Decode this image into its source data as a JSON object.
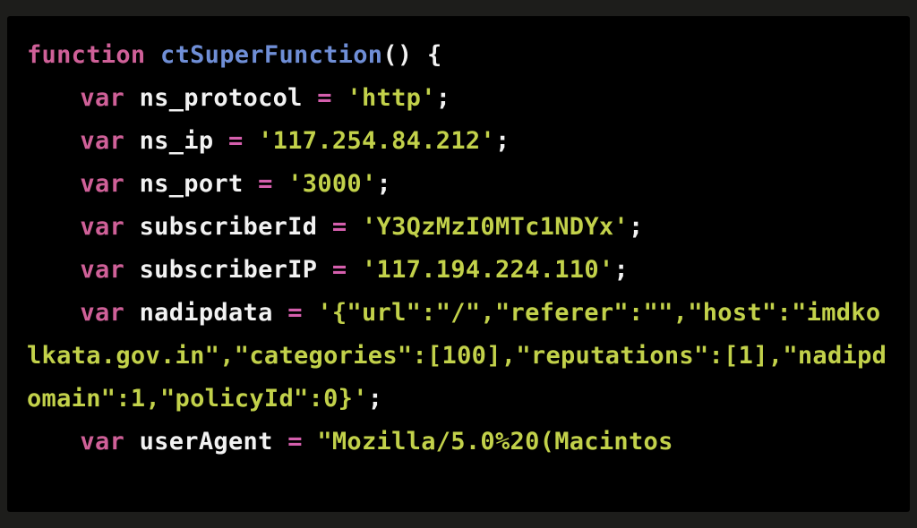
{
  "code": {
    "lang": "javascript",
    "tokens": {
      "kw_function": "function",
      "fn_name": "ctSuperFunction",
      "paren_open": "(",
      "paren_close": ")",
      "brace_open": "{",
      "kw_var": "var",
      "id_ns_protocol": "ns_protocol",
      "op_eq": "=",
      "str_http": "'http'",
      "semi": ";",
      "id_ns_ip": "ns_ip",
      "str_ns_ip": "'117.254.84.212'",
      "id_ns_port": "ns_port",
      "str_ns_port": "'3000'",
      "id_subscriberId": "subscriberId",
      "str_subscriberId": "'Y3QzMzI0MTc1NDYx'",
      "id_subscriberIP": "subscriberIP",
      "str_subscriberIP": "'117.194.224.110'",
      "id_nadipdata": "nadipdata",
      "str_nadipdata": "'{\"url\":\"/\",\"referer\":\"\",\"host\":\"imdkolkata.gov.in\",\"categories\":[100],\"reputations\":[1],\"nadipdomain\":1,\"policyId\":0}'",
      "id_userAgent": "userAgent",
      "str_userAgent": "\"Mozilla/5.0%20(Macintos"
    }
  }
}
